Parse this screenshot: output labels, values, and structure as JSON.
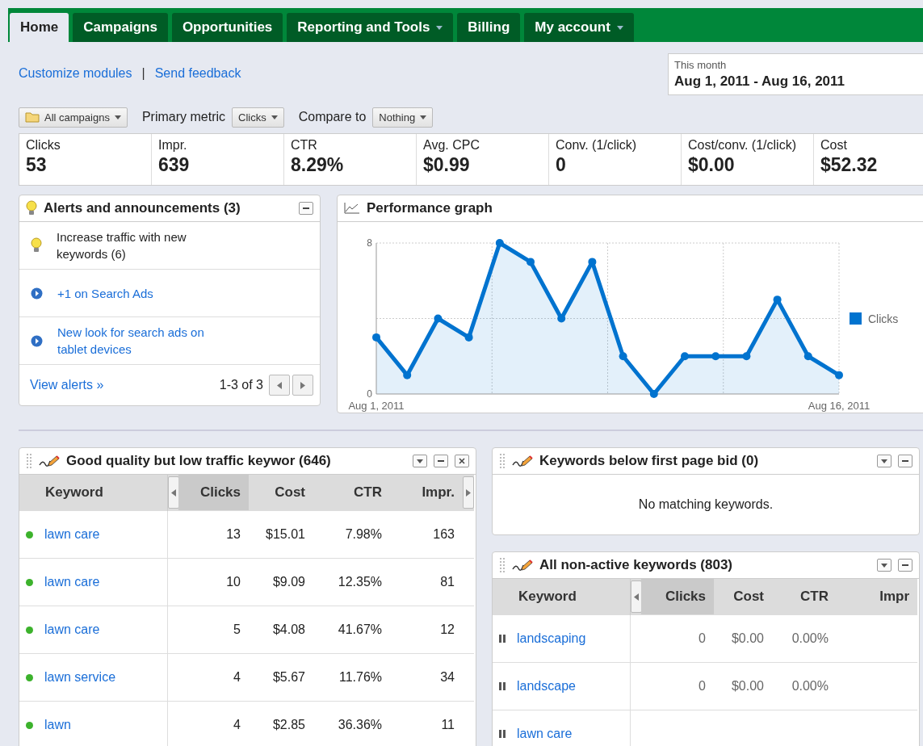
{
  "tabs": [
    {
      "label": "Home",
      "selected": true,
      "dropdown": false
    },
    {
      "label": "Campaigns",
      "selected": false,
      "dropdown": false
    },
    {
      "label": "Opportunities",
      "selected": false,
      "dropdown": false
    },
    {
      "label": "Reporting and Tools",
      "selected": false,
      "dropdown": true
    },
    {
      "label": "Billing",
      "selected": false,
      "dropdown": false
    },
    {
      "label": "My account",
      "selected": false,
      "dropdown": true
    }
  ],
  "links": {
    "customize": "Customize modules",
    "separator": "|",
    "feedback": "Send feedback"
  },
  "date_range": {
    "label": "This month",
    "value": "Aug 1, 2011 - Aug 16, 2011"
  },
  "filters": {
    "campaigns": "All campaigns",
    "primary_metric_label": "Primary metric",
    "primary_metric": "Clicks",
    "compare_label": "Compare to",
    "compare": "Nothing"
  },
  "metrics": [
    {
      "label": "Clicks",
      "value": "53"
    },
    {
      "label": "Impr.",
      "value": "639"
    },
    {
      "label": "CTR",
      "value": "8.29%"
    },
    {
      "label": "Avg. CPC",
      "value": "$0.99"
    },
    {
      "label": "Conv. (1/click)",
      "value": "0"
    },
    {
      "label": "Cost/conv. (1/click)",
      "value": "$0.00"
    },
    {
      "label": "Cost",
      "value": "$52.32"
    }
  ],
  "alerts": {
    "title": "Alerts and announcements (3)",
    "items": [
      {
        "kind": "tip",
        "text": "Increase traffic with new keywords (6)"
      },
      {
        "kind": "announcement",
        "text": "+1 on Search Ads"
      },
      {
        "kind": "announcement",
        "text": "New look for search ads on tablet devices"
      }
    ],
    "view_link": "View alerts »",
    "pager": "1-3 of 3"
  },
  "performance": {
    "title": "Performance graph",
    "chart_data": {
      "type": "area",
      "categories": [
        "Aug 1, 2011",
        null,
        null,
        null,
        null,
        null,
        null,
        null,
        null,
        null,
        null,
        null,
        null,
        null,
        null,
        "Aug 16, 2011"
      ],
      "series": [
        {
          "name": "Clicks",
          "color": "#0073cf",
          "values": [
            3,
            1,
            4,
            3,
            8,
            7,
            4,
            7,
            2,
            0,
            2,
            2,
            2,
            5,
            2,
            1
          ]
        }
      ],
      "ylim": [
        0,
        8
      ],
      "yticks": [
        0,
        8
      ]
    }
  },
  "modules": [
    {
      "title": "Good quality but low traffic keywor (646)",
      "controls": [
        {
          "kind": "menu"
        },
        {
          "kind": "minimize"
        },
        {
          "kind": "close"
        }
      ],
      "columns": [
        {
          "label": "Keyword",
          "sorted": false
        },
        {
          "label": "Clicks",
          "sorted": true
        },
        {
          "label": "Cost",
          "sorted": false
        },
        {
          "label": "CTR",
          "sorted": false
        },
        {
          "label": "Impr.",
          "sorted": false
        }
      ],
      "rows": [
        {
          "paused": false,
          "cells": [
            "lawn care",
            "13",
            "$15.01",
            "7.98%",
            "163"
          ]
        },
        {
          "paused": false,
          "cells": [
            "lawn care",
            "10",
            "$9.09",
            "12.35%",
            "81"
          ]
        },
        {
          "paused": false,
          "cells": [
            "lawn care",
            "5",
            "$4.08",
            "41.67%",
            "12"
          ]
        },
        {
          "paused": false,
          "cells": [
            "lawn service",
            "4",
            "$5.67",
            "11.76%",
            "34"
          ]
        },
        {
          "paused": false,
          "cells": [
            "lawn",
            "4",
            "$2.85",
            "36.36%",
            "11"
          ]
        }
      ]
    },
    {
      "title": "Keywords below first page bid (0)",
      "controls": [
        {
          "kind": "menu"
        },
        {
          "kind": "minimize"
        }
      ],
      "empty": "No matching keywords."
    },
    {
      "title": "All non-active keywords (803)",
      "controls": [
        {
          "kind": "menu"
        },
        {
          "kind": "minimize"
        }
      ],
      "columns": [
        {
          "label": "Keyword",
          "sorted": false
        },
        {
          "label": "Clicks",
          "sorted": true
        },
        {
          "label": "Cost",
          "sorted": false
        },
        {
          "label": "CTR",
          "sorted": false
        },
        {
          "label": "Impr",
          "sorted": false
        }
      ],
      "rows": [
        {
          "paused": true,
          "cells": [
            "landscaping",
            "0",
            "$0.00",
            "0.00%"
          ]
        },
        {
          "paused": true,
          "cells": [
            "landscape",
            "0",
            "$0.00",
            "0.00%"
          ]
        },
        {
          "paused": true,
          "cells": [
            "lawn care"
          ]
        }
      ]
    }
  ]
}
